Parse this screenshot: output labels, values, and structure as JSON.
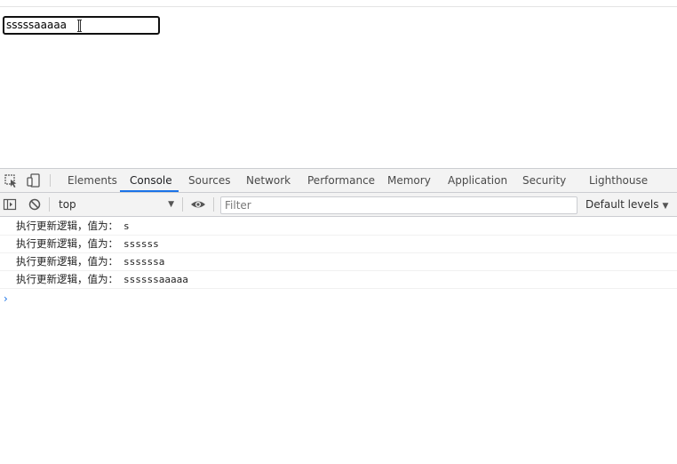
{
  "page": {
    "input_value": "sssssaaaaa"
  },
  "devtools": {
    "tabs": [
      {
        "label": "Elements"
      },
      {
        "label": "Console"
      },
      {
        "label": "Sources"
      },
      {
        "label": "Network"
      },
      {
        "label": "Performance"
      },
      {
        "label": "Memory"
      },
      {
        "label": "Application"
      },
      {
        "label": "Security"
      },
      {
        "label": "Lighthouse"
      }
    ],
    "active_tab": "Console",
    "toolbar": {
      "context": "top",
      "filter_placeholder": "Filter",
      "levels": "Default levels"
    },
    "console": {
      "messages": [
        {
          "prefix": "执行更新逻辑，值为：",
          "value": "s"
        },
        {
          "prefix": "执行更新逻辑，值为：",
          "value": "ssssss"
        },
        {
          "prefix": "执行更新逻辑，值为：",
          "value": "ssssssa"
        },
        {
          "prefix": "执行更新逻辑，值为：",
          "value": "ssssssaaaaa"
        }
      ],
      "prompt_symbol": "›"
    },
    "colors": {
      "accent": "#1a73e8",
      "tab_bg": "#f3f3f3",
      "border": "#cbcdd1"
    },
    "icons": [
      "inspect-element-icon",
      "device-toolbar-icon",
      "sidebar-toggle-icon",
      "clear-console-icon",
      "live-expression-eye-icon"
    ]
  }
}
